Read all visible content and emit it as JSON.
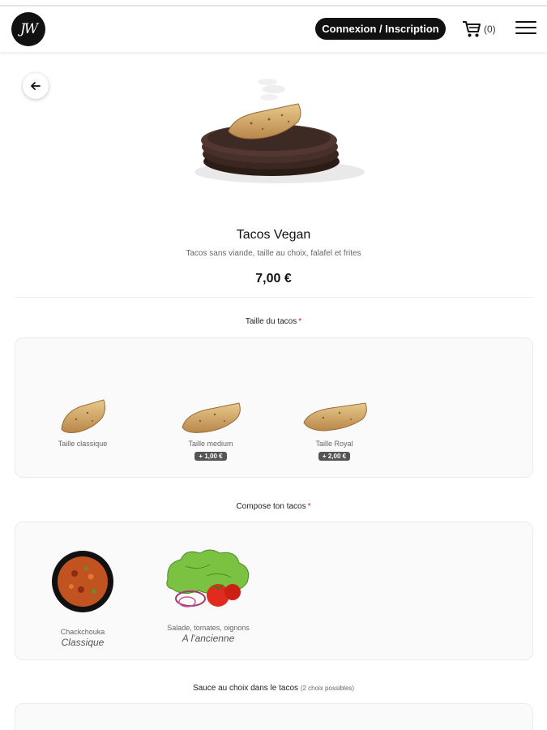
{
  "header": {
    "logo_text": "JW",
    "login_label": "Connexion / Inscription",
    "cart_count": "(0)"
  },
  "product": {
    "title": "Tacos Vegan",
    "description": "Tacos sans viande, taille au choix, falafel et   frites",
    "price": "7,00 €"
  },
  "size_section": {
    "title": "Taille du tacos",
    "required_mark": "*",
    "options": [
      {
        "label": "Taille classique",
        "extra": ""
      },
      {
        "label": "Taille medium",
        "extra": "+ 1,00 €"
      },
      {
        "label": "Taille Royal",
        "extra": "+ 2,00 €"
      }
    ]
  },
  "compose_section": {
    "title": "Compose ton tacos",
    "required_mark": "*",
    "options": [
      {
        "label": "Chackchouka",
        "sub": "Classique"
      },
      {
        "label": "Salade, tomates, oignons",
        "sub": "A l'ancienne"
      }
    ]
  },
  "sauce_section": {
    "title": "Sauce au choix dans le tacos",
    "hint": "(2 choix possibles)"
  },
  "colors": {
    "accent": "#111111",
    "required": "#e01919",
    "badge": "#555555"
  },
  "icons": [
    "cart-icon",
    "menu-icon",
    "back-arrow-icon"
  ]
}
